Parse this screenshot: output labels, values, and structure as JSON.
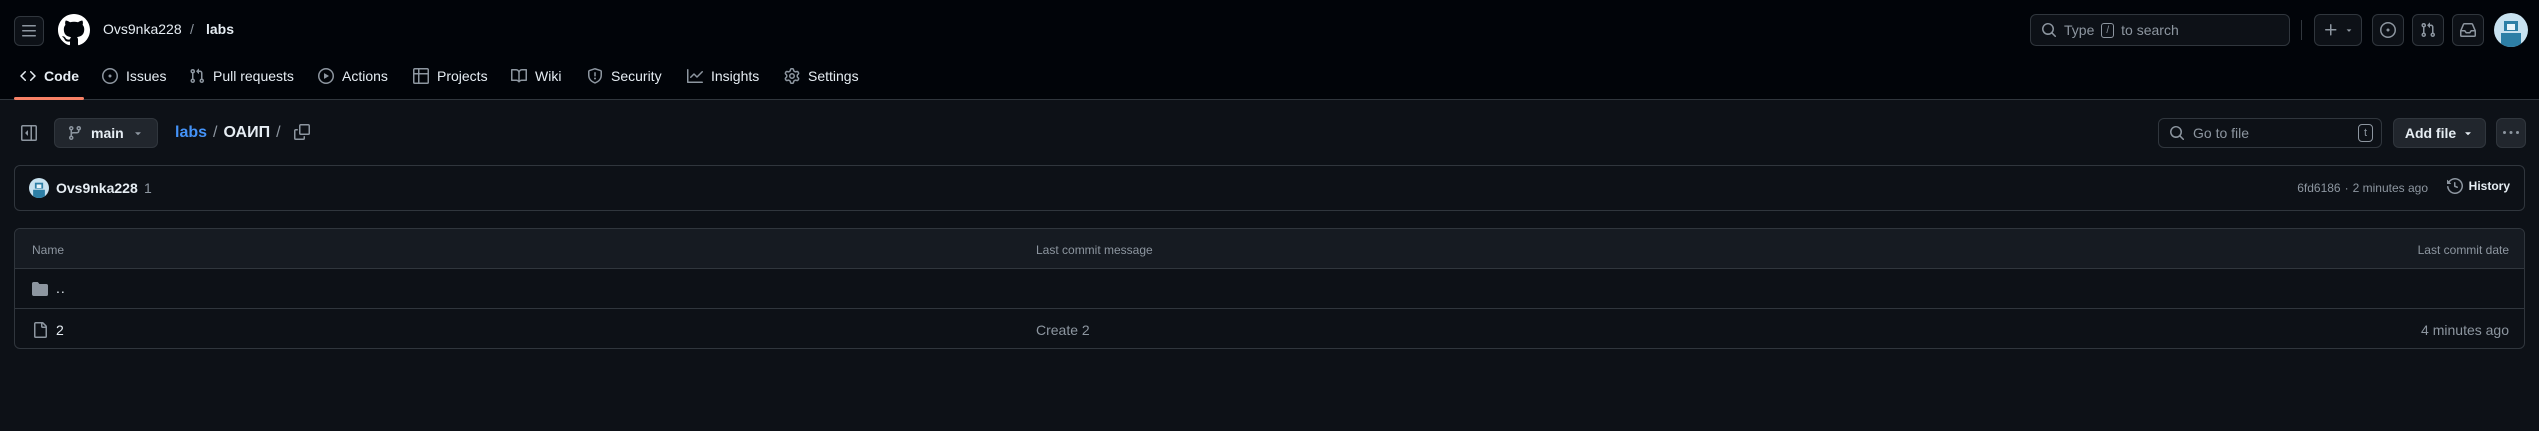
{
  "header": {
    "owner": "Ovs9nka228",
    "separator": "/",
    "repo": "labs",
    "search": {
      "prefix": "Type",
      "key": "/",
      "suffix": "to search"
    }
  },
  "nav": {
    "tabs": [
      {
        "label": "Code",
        "icon": "code-icon",
        "active": true
      },
      {
        "label": "Issues",
        "icon": "issue-icon"
      },
      {
        "label": "Pull requests",
        "icon": "pull-request-icon"
      },
      {
        "label": "Actions",
        "icon": "play-icon"
      },
      {
        "label": "Projects",
        "icon": "table-icon"
      },
      {
        "label": "Wiki",
        "icon": "book-icon"
      },
      {
        "label": "Security",
        "icon": "shield-icon"
      },
      {
        "label": "Insights",
        "icon": "graph-icon"
      },
      {
        "label": "Settings",
        "icon": "gear-icon"
      }
    ]
  },
  "toolbar": {
    "branch": "main",
    "breadcrumb": {
      "repo": "labs",
      "sep1": "/",
      "folder": "ОАИП",
      "sep2": "/"
    },
    "goto_placeholder": "Go to file",
    "goto_key": "t",
    "add_file": "Add file"
  },
  "commit": {
    "author": "Ovs9nka228",
    "message": "1",
    "sha": "6fd6186",
    "dot": "·",
    "time": "2 minutes ago",
    "history": "History"
  },
  "table": {
    "headers": {
      "name": "Name",
      "message": "Last commit message",
      "date": "Last commit date"
    },
    "parent": "..",
    "rows": [
      {
        "name": "2",
        "message": "Create 2",
        "date": "4 minutes ago",
        "icon": "file-icon"
      }
    ]
  },
  "colors": {
    "accent": "#f78166",
    "link": "#4493f8",
    "bg": "#0d1117",
    "header_bg": "#010409",
    "border": "#30363d"
  }
}
